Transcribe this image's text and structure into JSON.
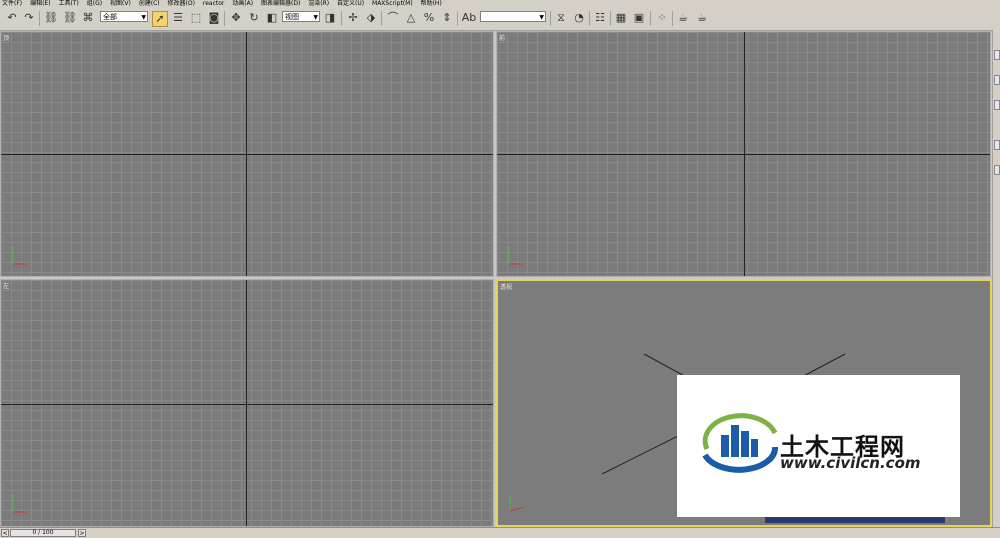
{
  "menu": {
    "items": [
      "文件(F)",
      "编辑(E)",
      "工具(T)",
      "组(G)",
      "视图(V)",
      "创建(C)",
      "修改器(O)",
      "reactor",
      "动画(A)",
      "图表编辑器(D)",
      "渲染(R)",
      "自定义(U)",
      "MAXScript(M)",
      "帮助(H)"
    ]
  },
  "toolbar": {
    "selection_filter": "全部",
    "reference_coord": "视图",
    "named_selection": ""
  },
  "viewports": {
    "top": {
      "label": "顶"
    },
    "front": {
      "label": "前"
    },
    "left": {
      "label": "左"
    },
    "perspective": {
      "label": "透视"
    }
  },
  "timeline": {
    "frame": "0 / 100",
    "prev": "<",
    "next": ">"
  },
  "watermark": {
    "title": "土木工程网",
    "url": "www.civilcn.com",
    "colors": {
      "blue": "#1a5ca8",
      "green": "#7cb342"
    }
  },
  "colors": {
    "active_viewport_border": "#e6d35a",
    "viewport_bg": "#7b7b7b",
    "ui_bg": "#d4d0c8"
  }
}
